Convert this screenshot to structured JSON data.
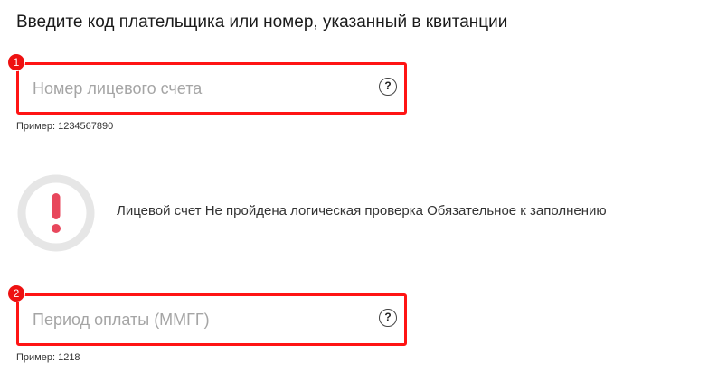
{
  "heading": "Введите код плательщика или номер, указанный в квитанции",
  "fields": [
    {
      "badge": "1",
      "value": "",
      "placeholder": "Номер лицевого счета",
      "help": "?",
      "hint": "Пример: 1234567890"
    },
    {
      "badge": "2",
      "value": "",
      "placeholder": "Период оплаты (ММГГ)",
      "help": "?",
      "hint": "Пример: 1218"
    }
  ],
  "error": {
    "icon": "exclamation-icon",
    "message": "Лицевой счет Не пройдена логическая проверка Обязательное к заполнению"
  },
  "colors": {
    "highlight_border": "#ff1414",
    "badge": "#ee1111",
    "error_icon": "#e8475c",
    "error_ring": "#e6e6e6",
    "placeholder": "#a5a5a5"
  }
}
